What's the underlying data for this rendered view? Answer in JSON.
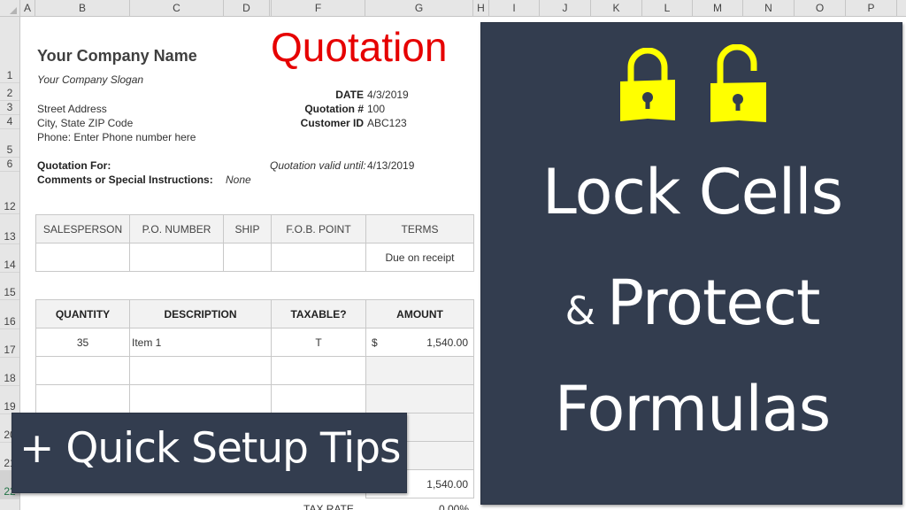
{
  "spreadsheet": {
    "columns": [
      "A",
      "B",
      "C",
      "D",
      "F",
      "G",
      "H",
      "I",
      "J",
      "K",
      "L",
      "M",
      "N",
      "O",
      "P"
    ],
    "rows": [
      "1",
      "2",
      "3",
      "4",
      "5",
      "6",
      "12",
      "13",
      "14",
      "15",
      "16",
      "17",
      "18",
      "19",
      "20",
      "21",
      "22"
    ],
    "selected_row": "22"
  },
  "quotation": {
    "company_name": "Your Company Name",
    "slogan": "Your Company Slogan",
    "title": "Quotation",
    "street": "Street Address",
    "city": "City, State ZIP Code",
    "phone": "Phone: Enter Phone number here",
    "date_label": "DATE",
    "date_value": "4/3/2019",
    "quote_no_label": "Quotation #",
    "quote_no_value": "100",
    "customer_id_label": "Customer ID",
    "customer_id_value": "ABC123",
    "quotation_for_label": "Quotation For:",
    "valid_until_label": "Quotation valid until:",
    "valid_until_value": "4/13/2019",
    "comments_label": "Comments or Special Instructions:",
    "comments_value": "None"
  },
  "info_table": {
    "headers": [
      "SALESPERSON",
      "P.O. NUMBER",
      "SHIP",
      "F.O.B. POINT",
      "TERMS"
    ],
    "values": [
      "",
      "",
      "",
      "",
      "Due on receipt"
    ]
  },
  "items_table": {
    "headers": {
      "quantity": "QUANTITY",
      "description": "DESCRIPTION",
      "taxable": "TAXABLE?",
      "amount": "AMOUNT"
    },
    "rows": [
      {
        "quantity": "35",
        "description": "Item 1",
        "taxable": "T",
        "currency": "$",
        "amount": "1,540.00"
      }
    ],
    "subtotal": "1,540.00",
    "tax_rate_label": "TAX RATE",
    "tax_rate_value": "0.00%"
  },
  "overlay": {
    "title_line1": "Lock Cells",
    "title_amp": "&",
    "title_line2": "Protect",
    "title_line3": "Formulas",
    "tips": "+ Quick Setup Tips",
    "lock_icons": [
      "lock-closed-icon",
      "lock-open-icon"
    ],
    "panel_color": "#333d4f",
    "lock_color": "#ffff00",
    "title_color": "#e60000"
  }
}
